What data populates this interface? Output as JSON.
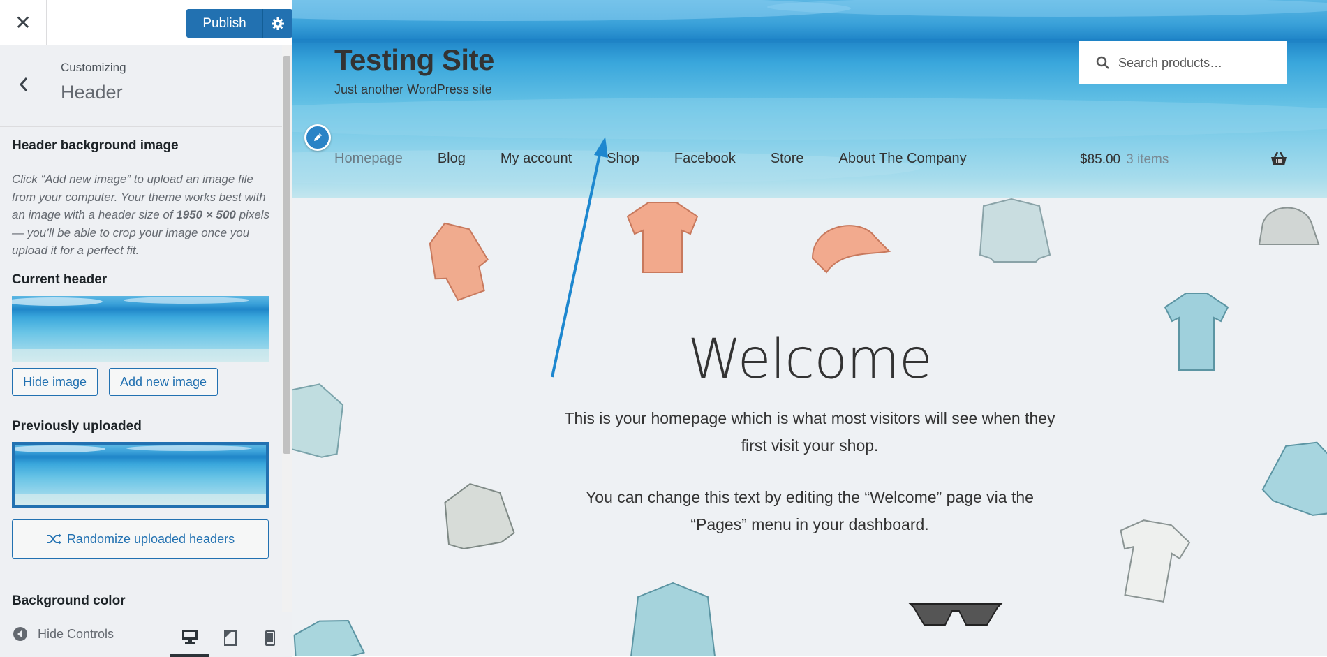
{
  "customizer": {
    "publish_label": "Publish",
    "breadcrumb": "Customizing",
    "section_title": "Header",
    "header_bg_title": "Header background image",
    "description_part1": "Click “Add new image” to upload an image file from your computer. Your theme works best with an image with a header size of ",
    "description_size": "1950 × 500",
    "description_part2": " pixels — you’ll be able to crop your image once you upload it for a perfect fit.",
    "current_header_label": "Current header",
    "hide_image_label": "Hide image",
    "add_new_image_label": "Add new image",
    "previously_uploaded_label": "Previously uploaded",
    "randomize_label": "Randomize uploaded headers",
    "background_color_label": "Background color",
    "hide_controls_label": "Hide Controls"
  },
  "site": {
    "title": "Testing Site",
    "tagline": "Just another WordPress site",
    "search_placeholder": "Search products…",
    "nav": [
      "Homepage",
      "Blog",
      "My account",
      "Shop",
      "Facebook",
      "Store",
      "About The Company"
    ],
    "cart_total": "$85.00",
    "cart_items": "3 items"
  },
  "content": {
    "welcome_title": "Welcome",
    "paragraph1": "This is your homepage which is what most visitors will see when they first visit your shop.",
    "paragraph2": "You can change this text by editing the “Welcome” page via the “Pages” menu in your dashboard."
  },
  "colors": {
    "accent": "#2271b1",
    "pencil": "#2a83c6",
    "arrow": "#1d87cf"
  }
}
